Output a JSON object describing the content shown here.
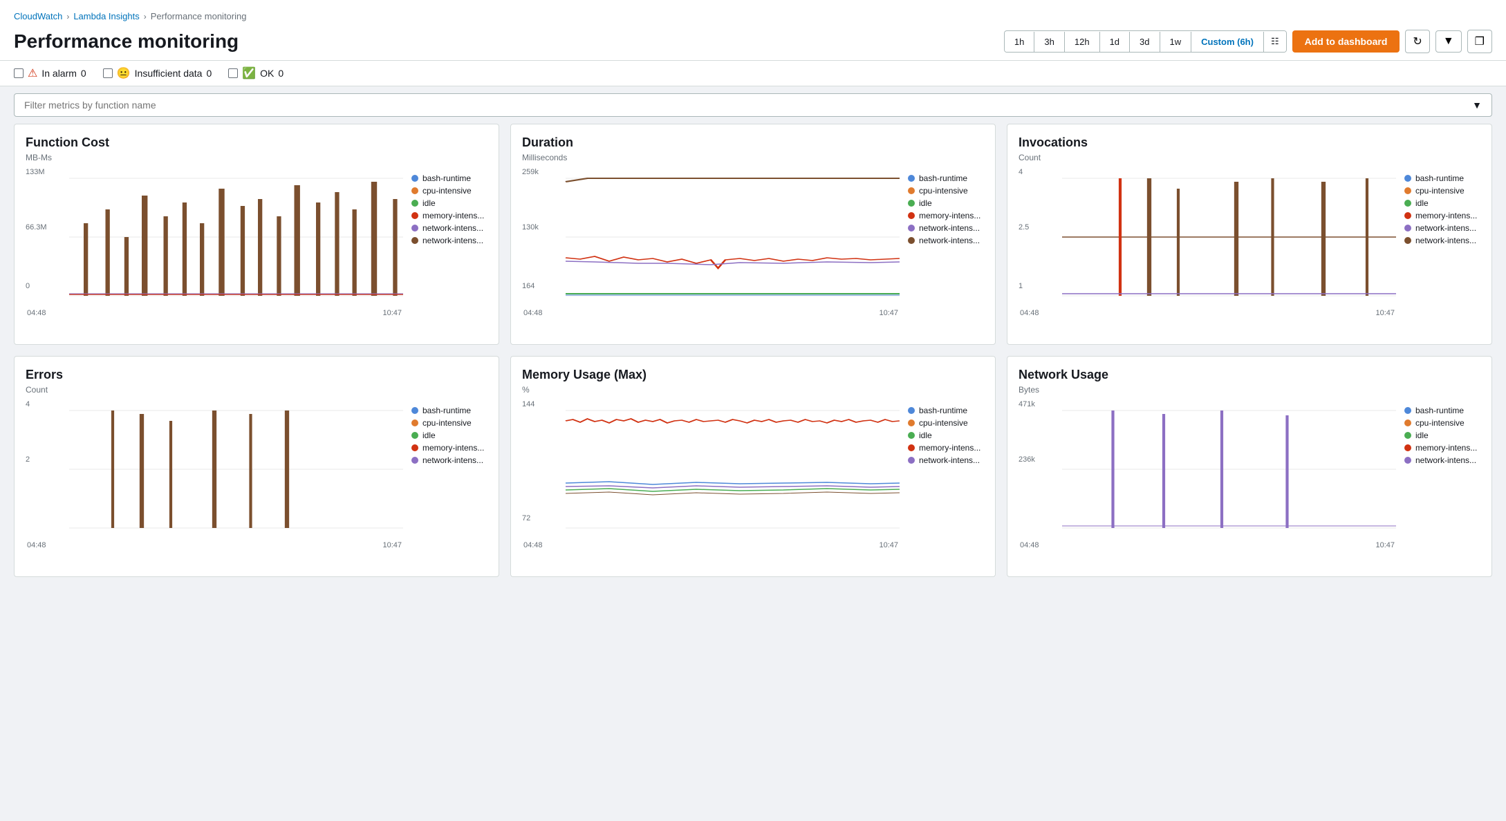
{
  "breadcrumb": {
    "cloudwatch": "CloudWatch",
    "lambda_insights": "Lambda Insights",
    "current": "Performance monitoring"
  },
  "page": {
    "title": "Performance monitoring"
  },
  "time_range": {
    "options": [
      "1h",
      "3h",
      "12h",
      "1d",
      "3d",
      "1w"
    ],
    "active": "Custom (6h)",
    "add_dashboard": "Add to dashboard"
  },
  "status": {
    "in_alarm_label": "In alarm",
    "in_alarm_count": "0",
    "insufficient_label": "Insufficient data",
    "insufficient_count": "0",
    "ok_label": "OK",
    "ok_count": "0"
  },
  "filter": {
    "placeholder": "Filter metrics by function name"
  },
  "charts": [
    {
      "id": "function-cost",
      "title": "Function Cost",
      "unit": "MB-Ms",
      "y_labels": [
        "133M",
        "66.3M",
        "0"
      ],
      "x_labels": [
        "04:48",
        "10:47"
      ]
    },
    {
      "id": "duration",
      "title": "Duration",
      "unit": "Milliseconds",
      "y_labels": [
        "259k",
        "130k",
        "164"
      ],
      "x_labels": [
        "04:48",
        "10:47"
      ]
    },
    {
      "id": "invocations",
      "title": "Invocations",
      "unit": "Count",
      "y_labels": [
        "4",
        "2.5",
        "1"
      ],
      "x_labels": [
        "04:48",
        "10:47"
      ]
    },
    {
      "id": "errors",
      "title": "Errors",
      "unit": "Count",
      "y_labels": [
        "4",
        "2",
        ""
      ],
      "x_labels": [
        "04:48",
        "10:47"
      ]
    },
    {
      "id": "memory-usage",
      "title": "Memory Usage (Max)",
      "unit": "%",
      "y_labels": [
        "144",
        "72",
        ""
      ],
      "x_labels": [
        "04:48",
        "10:47"
      ]
    },
    {
      "id": "network-usage",
      "title": "Network Usage",
      "unit": "Bytes",
      "y_labels": [
        "471k",
        "236k",
        ""
      ],
      "x_labels": [
        "04:48",
        "10:47"
      ]
    }
  ],
  "legend": {
    "items": [
      {
        "label": "bash-runtime",
        "color": "#4e88d9"
      },
      {
        "label": "cpu-intensive",
        "color": "#e07b2e"
      },
      {
        "label": "idle",
        "color": "#4aad52"
      },
      {
        "label": "memory-intens...",
        "color": "#d13212"
      },
      {
        "label": "network-intens...",
        "color": "#8c6fc3"
      },
      {
        "label": "network-intens...",
        "color": "#7b4f2e"
      }
    ]
  }
}
